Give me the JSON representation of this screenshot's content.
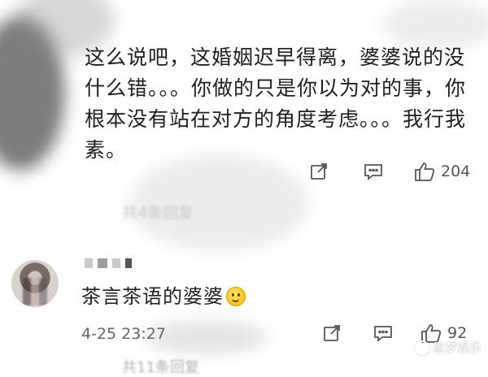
{
  "comment": {
    "text": "这么说吧，这婚姻迟早得离，婆婆说的没什么错。。。你做的只是你以为对的事，你根本没有站在对方的角度考虑。。。我行我素。",
    "ghost_reply": "共4条回复",
    "actions": {
      "like_count": "204"
    }
  },
  "reply": {
    "text": "茶言茶语的婆婆",
    "emoji": "smile-emoji",
    "timestamp": "4-25 23:27",
    "actions": {
      "like_count": "92"
    },
    "ghost_more": "共11条回复"
  },
  "watermark": "星梦娱乐",
  "icons": [
    "forward-icon",
    "comment-icon",
    "like-icon",
    "smile-emoji-icon"
  ],
  "colors": {
    "text": "#1f1f1f",
    "meta": "#555555",
    "background": "#ffffff"
  }
}
